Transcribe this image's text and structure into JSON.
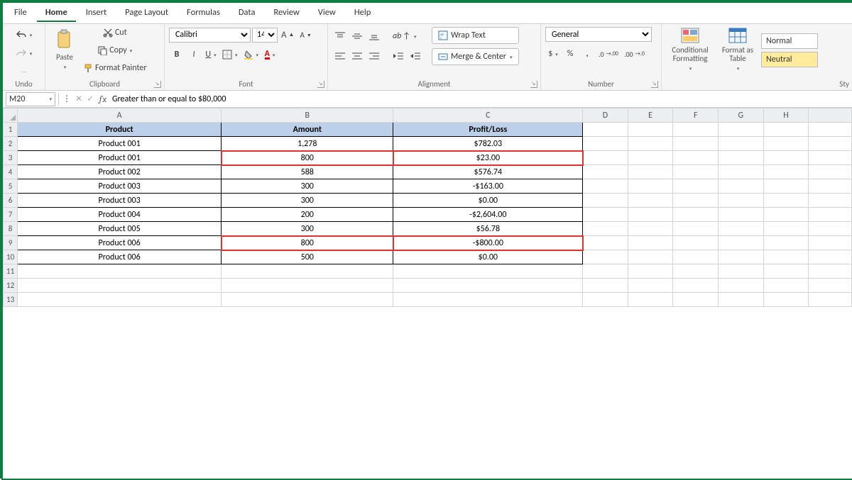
{
  "menu": {
    "items": [
      "File",
      "Home",
      "Insert",
      "Page Layout",
      "Formulas",
      "Data",
      "Review",
      "View",
      "Help"
    ],
    "active": "Home"
  },
  "ribbon": {
    "undo_label": "Undo",
    "clipboard": {
      "paste": "Paste",
      "cut": "Cut",
      "copy": "Copy",
      "fmtpaint": "Format Painter",
      "label": "Clipboard"
    },
    "font": {
      "name": "Calibri",
      "size": "14",
      "label": "Font"
    },
    "align": {
      "wrap": "Wrap Text",
      "merge": "Merge & Center",
      "label": "Alignment"
    },
    "number": {
      "fmt": "General",
      "label": "Number"
    },
    "styles": {
      "cond": "Conditional Formatting",
      "tbl": "Format as Table",
      "normal": "Normal",
      "neutral": "Neutral",
      "label": "Sty"
    }
  },
  "namebox": "M20",
  "formula": "Greater than or equal to $80,000",
  "columns": [
    "A",
    "B",
    "C",
    "D",
    "E",
    "F",
    "G",
    "H"
  ],
  "data": {
    "headers": [
      "Product",
      "Amount",
      "Profit/Loss"
    ],
    "rows": [
      {
        "p": "Product 001",
        "a": "1,278",
        "pl": "$782.03",
        "hl": false
      },
      {
        "p": "Product 001",
        "a": "800",
        "pl": "$23.00",
        "hl": true
      },
      {
        "p": "Product 002",
        "a": "588",
        "pl": "$576.74",
        "hl": false
      },
      {
        "p": "Product 003",
        "a": "300",
        "pl": "-$163.00",
        "hl": false
      },
      {
        "p": "Product 003",
        "a": "300",
        "pl": "$0.00",
        "hl": false
      },
      {
        "p": "Product 004",
        "a": "200",
        "pl": "-$2,604.00",
        "hl": false
      },
      {
        "p": "Product 005",
        "a": "300",
        "pl": "$56.78",
        "hl": false
      },
      {
        "p": "Product 006",
        "a": "800",
        "pl": "-$800.00",
        "hl": true
      },
      {
        "p": "Product 006",
        "a": "500",
        "pl": "$0.00",
        "hl": false
      }
    ]
  }
}
